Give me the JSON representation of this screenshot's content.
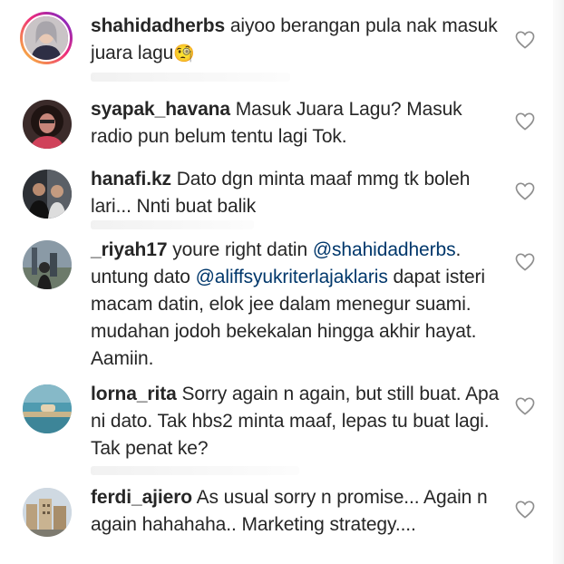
{
  "comments": [
    {
      "username": "shahidadherbs",
      "text": "aiyoo berangan pula nak masuk juara lagu",
      "emoji": "🧐"
    },
    {
      "username": "syapak_havana",
      "text": "Masuk Juara Lagu? Masuk radio pun belum tentu lagi Tok."
    },
    {
      "username": "hanafi.kz",
      "text": "Dato dgn minta maaf mmg tk boleh lari... Nnti buat balik"
    },
    {
      "username": "_riyah17",
      "text_a": "youre right datin ",
      "mention_1": "@shahidadherbs",
      "text_b": ". untung dato ",
      "mention_2": "@aliffsyukriterlajaklaris",
      "text_c": " dapat isteri macam datin, elok jee dalam menegur suami. mudahan jodoh bekekalan hingga akhir hayat. Aamiin."
    },
    {
      "username": "lorna_rita",
      "text": "Sorry again n again, but still buat. Apa ni dato. Tak hbs2 minta maaf, lepas tu buat lagi. Tak penat ke?"
    },
    {
      "username": "ferdi_ajiero",
      "text": "As usual sorry n promise... Again n again hahahaha.. Marketing strategy...."
    }
  ],
  "icons": {
    "like": "heart-outline-icon",
    "avatar": "profile-picture"
  },
  "colors": {
    "text": "#262626",
    "mention": "#00376b",
    "heart_stroke": "#8e8e8e",
    "story_ring_start": "#f9ce34",
    "story_ring_end": "#6228d7"
  }
}
